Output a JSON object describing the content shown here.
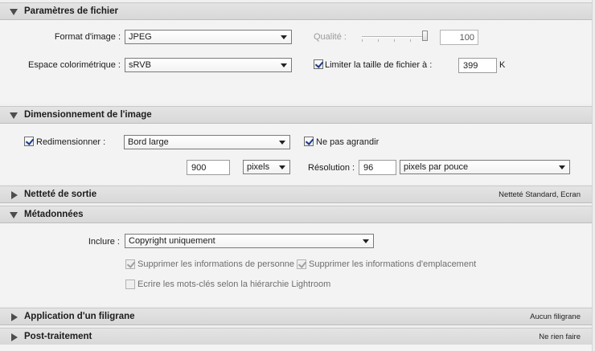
{
  "sections": {
    "file": {
      "title": "Paramètres de fichier",
      "format_label": "Format d'image :",
      "format_value": "JPEG",
      "quality_label": "Qualité :",
      "quality_value": "100",
      "quality_level": 1.0,
      "colorspace_label": "Espace colorimétrique :",
      "colorspace_value": "sRVB",
      "limit_label": "Limiter la taille de fichier à :",
      "limit_checked": true,
      "limit_value": "399",
      "limit_unit": "K"
    },
    "sizing": {
      "title": "Dimensionnement de l'image",
      "resize_label": "Redimensionner :",
      "resize_checked": true,
      "resize_mode": "Bord large",
      "no_enlarge_label": "Ne pas agrandir",
      "no_enlarge_checked": true,
      "size_value": "900",
      "size_unit": "pixels",
      "resolution_label": "Résolution :",
      "resolution_value": "96",
      "resolution_unit": "pixels par pouce"
    },
    "sharpening": {
      "title": "Netteté de sortie",
      "summary": "Netteté Standard, Ecran"
    },
    "metadata": {
      "title": "Métadonnées",
      "include_label": "Inclure :",
      "include_value": "Copyright uniquement",
      "remove_person_label": "Supprimer les informations de personne",
      "remove_location_label": "Supprimer les informations d'emplacement",
      "keywords_label": "Ecrire les mots-clés selon la hiérarchie Lightroom"
    },
    "watermark": {
      "title": "Application d'un filigrane",
      "summary": "Aucun filigrane"
    },
    "postprocess": {
      "title": "Post-traitement",
      "summary": "Ne rien faire"
    }
  }
}
